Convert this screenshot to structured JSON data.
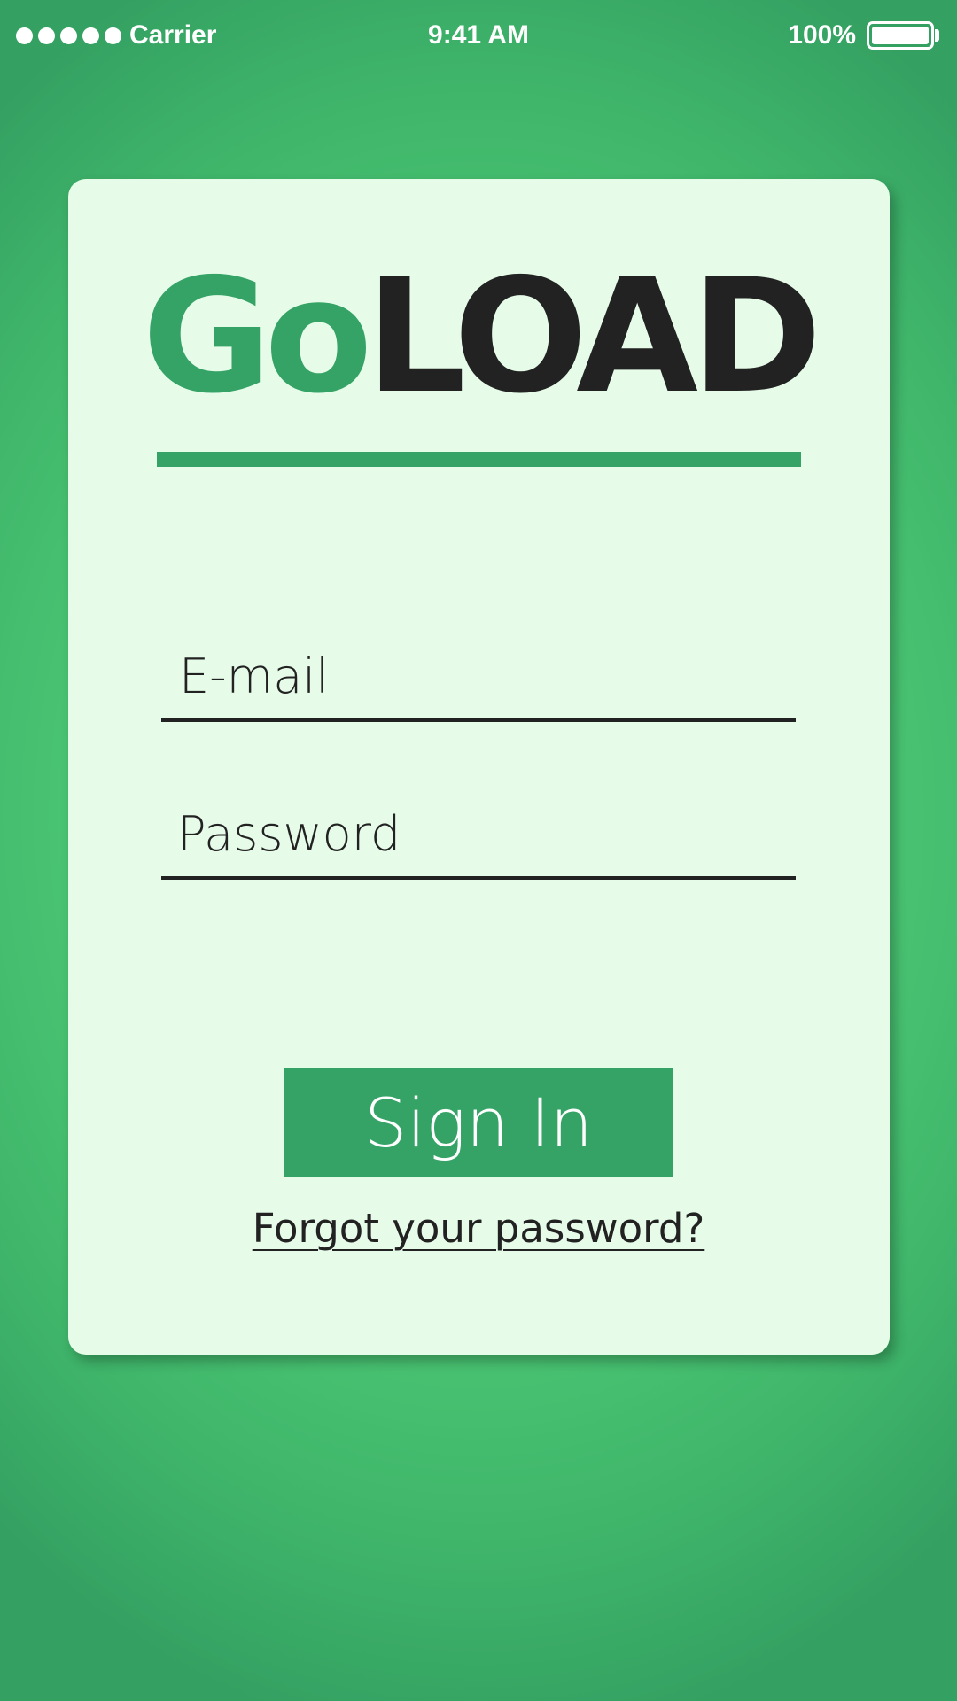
{
  "status_bar": {
    "carrier": "Carrier",
    "time": "9:41 AM",
    "battery_percent": "100%",
    "battery_level": 1.0,
    "signal_bars": 5
  },
  "app": {
    "logo_part1": "Go",
    "logo_part2": "LOAD",
    "brand_color": "#35a366",
    "text_color": "#222222",
    "background_color": "#4ecb76",
    "card_color": "#e6fce9"
  },
  "login_form": {
    "email_placeholder": "E-mail",
    "email_value": "",
    "password_placeholder": "Password",
    "password_value": "",
    "sign_in_label": "Sign In",
    "forgot_password_label": "Forgot your password?"
  },
  "icons": {
    "signal": "signal-dots-icon",
    "battery": "battery-icon"
  }
}
